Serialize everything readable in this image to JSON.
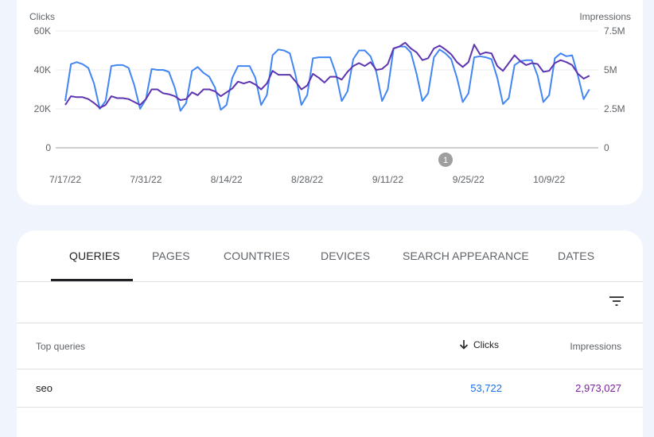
{
  "chart_data": {
    "type": "line",
    "left_axis_label": "Clicks",
    "right_axis_label": "Impressions",
    "left_ticks": [
      "0",
      "20K",
      "40K",
      "60K"
    ],
    "right_ticks": [
      "0",
      "2.5M",
      "5M",
      "7.5M"
    ],
    "left_ylim": [
      0,
      60000
    ],
    "right_ylim": [
      0,
      7500000
    ],
    "x_tick_labels": [
      "7/17/22",
      "7/31/22",
      "8/14/22",
      "8/28/22",
      "9/11/22",
      "9/25/22",
      "10/9/22"
    ],
    "x_range": [
      "2022-07-17",
      "2022-10-16"
    ],
    "grid": true,
    "annotation_label": "1",
    "annotation_date": "2022-09-22",
    "series": [
      {
        "name": "Clicks",
        "axis": "left",
        "color": "#4285f4",
        "values": [
          24000,
          43000,
          44000,
          43000,
          41000,
          33000,
          20000,
          24000,
          42000,
          42500,
          42500,
          41000,
          32000,
          20000,
          25000,
          40500,
          40000,
          40000,
          39000,
          31000,
          19000,
          23000,
          39500,
          41500,
          38500,
          36500,
          31000,
          19500,
          22000,
          36000,
          42000,
          42000,
          42000,
          36000,
          22000,
          27000,
          47500,
          50500,
          50000,
          48500,
          37000,
          22000,
          27000,
          46000,
          46500,
          46500,
          46500,
          38000,
          24000,
          29000,
          45500,
          50000,
          50000,
          47000,
          39000,
          24000,
          30000,
          51000,
          52000,
          52000,
          49000,
          38000,
          24000,
          28000,
          46500,
          50500,
          48500,
          45500,
          36000,
          23500,
          28000,
          46500,
          47000,
          46500,
          45500,
          36000,
          22500,
          25500,
          42500,
          44500,
          45000,
          45000,
          37000,
          23500,
          27000,
          46000,
          48500,
          47000,
          47500,
          37000,
          25000,
          30000
        ]
      },
      {
        "name": "Impressions",
        "axis": "right",
        "color": "#5e35b1",
        "values": [
          2750000,
          3310000,
          3250000,
          3250000,
          3130000,
          2880000,
          2560000,
          2750000,
          3310000,
          3190000,
          3190000,
          3130000,
          2940000,
          2750000,
          3130000,
          3750000,
          3750000,
          3500000,
          3440000,
          3310000,
          3060000,
          3130000,
          3560000,
          3380000,
          3750000,
          3750000,
          3630000,
          3310000,
          3560000,
          3810000,
          4250000,
          4130000,
          4250000,
          4060000,
          3750000,
          4130000,
          4940000,
          4690000,
          4690000,
          4690000,
          4250000,
          3750000,
          4000000,
          4750000,
          4500000,
          4190000,
          4560000,
          4560000,
          4380000,
          4880000,
          5250000,
          5440000,
          5250000,
          5500000,
          5000000,
          5060000,
          5380000,
          6380000,
          6500000,
          6750000,
          6380000,
          6130000,
          5630000,
          5750000,
          6380000,
          6560000,
          6310000,
          6000000,
          5500000,
          5190000,
          5500000,
          6630000,
          6000000,
          6130000,
          6060000,
          5250000,
          4940000,
          5440000,
          5940000,
          5560000,
          5310000,
          5440000,
          5380000,
          4880000,
          4940000,
          5440000,
          5630000,
          5500000,
          5310000,
          4750000,
          4440000,
          4630000
        ]
      }
    ]
  },
  "tabs": [
    {
      "label": "QUERIES",
      "active": true
    },
    {
      "label": "PAGES"
    },
    {
      "label": "COUNTRIES"
    },
    {
      "label": "DEVICES"
    },
    {
      "label": "SEARCH APPEARANCE"
    },
    {
      "label": "DATES"
    }
  ],
  "filter_icon": "filter-list-icon",
  "table": {
    "headers": {
      "query": "Top queries",
      "clicks": "Clicks",
      "impressions": "Impressions"
    },
    "sort_icon": "arrow-down-icon",
    "rows": [
      {
        "query": "seo",
        "clicks": "53,722",
        "impressions": "2,973,027"
      }
    ],
    "colors": {
      "clicks": "#1a73e8",
      "impressions": "#7b1fa2"
    }
  }
}
